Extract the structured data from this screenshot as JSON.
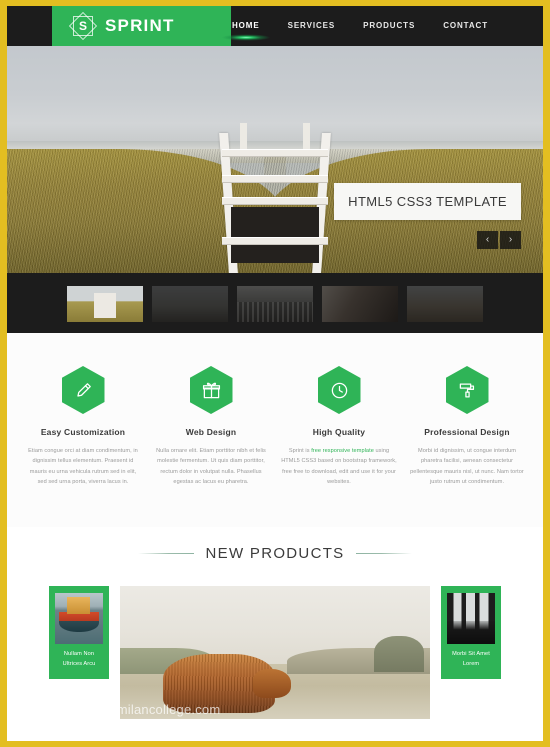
{
  "theme": {
    "frame_color": "#e3be21",
    "accent_green": "#2fb457",
    "header_dark": "#1c1c1c",
    "text_dark": "#3b3b3b",
    "muted_text": "#9a9a9a"
  },
  "header": {
    "logo": {
      "mark_letter": "S",
      "icon": "eight-point-star-icon",
      "text": "SPRINT"
    },
    "nav": [
      {
        "label": "HOME",
        "active": true
      },
      {
        "label": "SERVICES",
        "active": false
      },
      {
        "label": "PRODUCTS",
        "active": false
      },
      {
        "label": "CONTACT",
        "active": false
      }
    ]
  },
  "hero": {
    "image_description": "white wooden beach staircase between grassy dunes leading to the sea",
    "caption": "HTML5 CSS3 TEMPLATE",
    "prev_arrow": "‹",
    "next_arrow": "›",
    "thumbnails": [
      {
        "name": "thumb-beach-stairs",
        "active": true
      },
      {
        "name": "thumb-foggy-field",
        "active": false
      },
      {
        "name": "thumb-city-skyline",
        "active": false
      },
      {
        "name": "thumb-harbour",
        "active": false
      },
      {
        "name": "thumb-coast",
        "active": false
      }
    ]
  },
  "features": [
    {
      "icon": "pencil-icon",
      "title": "Easy Customization",
      "text": "Etiam congue orci at diam condimentum, in dignissim tellus elementum. Praesent id mauris eu urna vehicula rutrum sed in elit, sed sed urna porta, viverra lacus in."
    },
    {
      "icon": "gift-icon",
      "title": "Web Design",
      "text": "Nulla ornare elit. Etiam porttitor nibh et felis molestie fermentum. Ut quis diam porttitor, rectum dolor in volutpat nulla. Phasellus egestas ac lacus eu pharetra."
    },
    {
      "icon": "clock-icon",
      "title": "High Quality",
      "text_before": "Sprint is ",
      "link_text": "free responsive template",
      "text_after": " using HTML5 CSS3 based on bootstrap framework, free free to download, edit and use it for your websites."
    },
    {
      "icon": "paint-roller-icon",
      "title": "Professional Design",
      "text": "Morbi id dignissim, ut congue interdum pharetra facilisi, aenean consectetur pellentesque mauris nisl, ut nunc. Nam tortor justo rutrum ut condimentum."
    }
  ],
  "products": {
    "section_title": "NEW PRODUCTS",
    "cards": [
      {
        "name": "product-card-left",
        "image": "fishing-boat-image",
        "label": "Nullam Non Ultrices Arcu"
      },
      {
        "name": "product-card-right",
        "image": "dark-interior-window-image",
        "label": "Morbi Sit Amet Lorem"
      }
    ],
    "featured": {
      "name": "featured-product-image",
      "image_description": "highland cow standing on a sandy dune landscape",
      "watermark": "www.thetidingsofmilancollege.com"
    }
  }
}
